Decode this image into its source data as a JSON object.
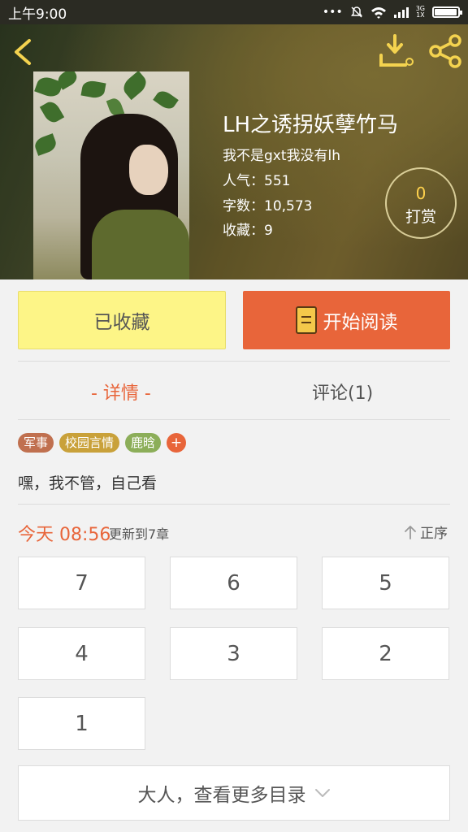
{
  "status_bar": {
    "time": "上午9:00",
    "network": "3G\n1X"
  },
  "book": {
    "title": "LH之诱拐妖孽竹马",
    "author": "我不是gxt我没有lh",
    "popularity": "人气：551",
    "word_count": "字数：10,573",
    "favorites": "收藏：9"
  },
  "reward": {
    "count": "0",
    "label": "打赏"
  },
  "actions": {
    "favorited_label": "已收藏",
    "read_label": "开始阅读"
  },
  "tabs": {
    "details": "- 详情 -",
    "comments": "评论(1)"
  },
  "tags": [
    {
      "label": "军事",
      "color": "#c0704f"
    },
    {
      "label": "校园言情",
      "color": "#c9a13a"
    },
    {
      "label": "鹿晗",
      "color": "#8cae59"
    }
  ],
  "tag_add": "+",
  "intro": "嘿，我不管，自己看",
  "update": {
    "time": "今天 08:56",
    "info": "更新到7章",
    "sort_label": "正序"
  },
  "chapters": [
    "7",
    "6",
    "5",
    "4",
    "3",
    "2",
    "1"
  ],
  "more_label": "大人，查看更多目录",
  "colors": {
    "accent": "#e8653a",
    "favorite_bg": "#fdf587",
    "icon_yellow": "#f4d34f"
  }
}
